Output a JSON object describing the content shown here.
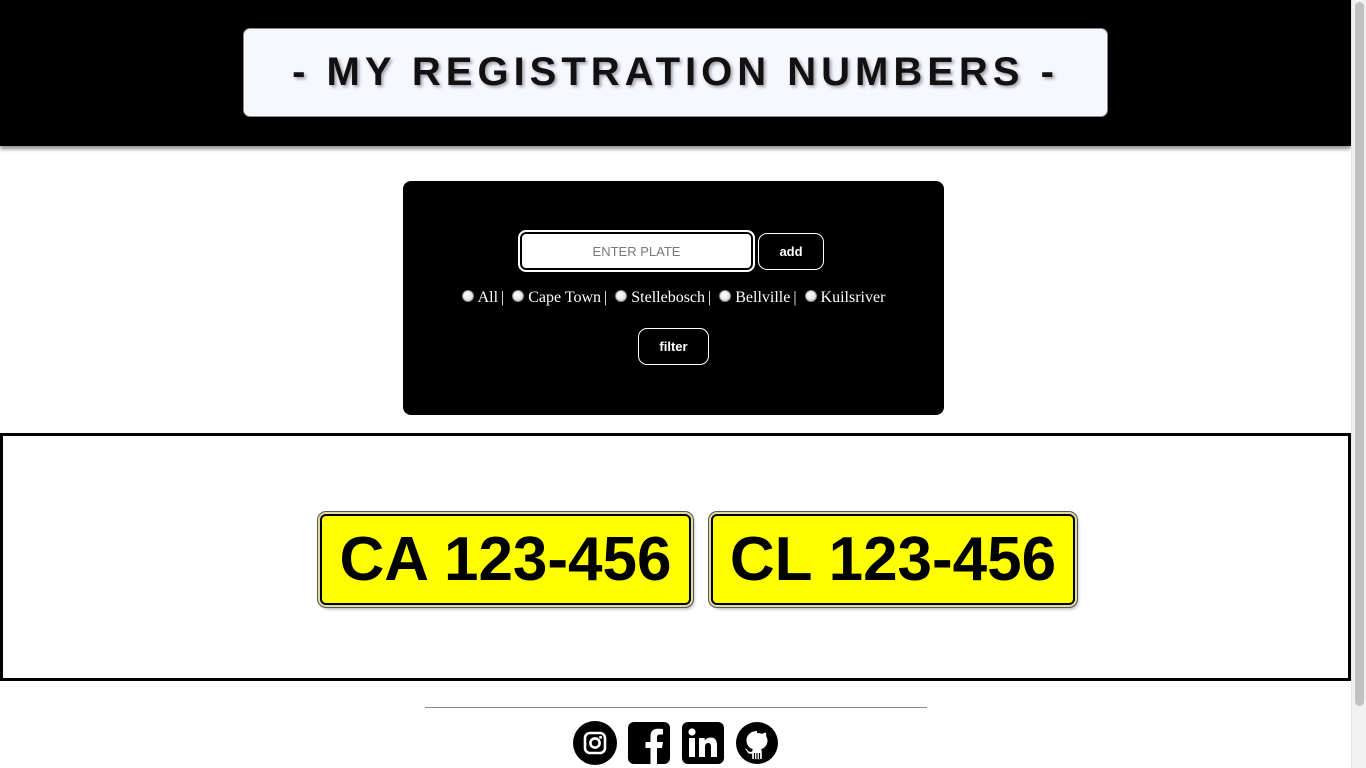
{
  "header": {
    "title": "- MY REGISTRATION NUMBERS -"
  },
  "controls": {
    "plate_input_placeholder": "ENTER PLATE",
    "plate_input_value": "",
    "add_label": "add",
    "filter_label": "filter",
    "towns": [
      {
        "label": "All",
        "separator": "|"
      },
      {
        "label": "Cape Town",
        "separator": "|"
      },
      {
        "label": "Stellebosch",
        "separator": "|"
      },
      {
        "label": "Bellville",
        "separator": "|"
      },
      {
        "label": "Kuilsriver",
        "separator": ""
      }
    ]
  },
  "plates": [
    {
      "number": "CA 123-456"
    },
    {
      "number": "CL 123-456"
    }
  ],
  "footer": {
    "social_icons": [
      "instagram-icon",
      "facebook-icon",
      "linkedin-icon",
      "github-icon"
    ]
  },
  "colors": {
    "header_bg": "#000000",
    "panel_bg": "#000000",
    "plate_bg": "#ffff00",
    "title_bg": "#f6f7ff"
  }
}
